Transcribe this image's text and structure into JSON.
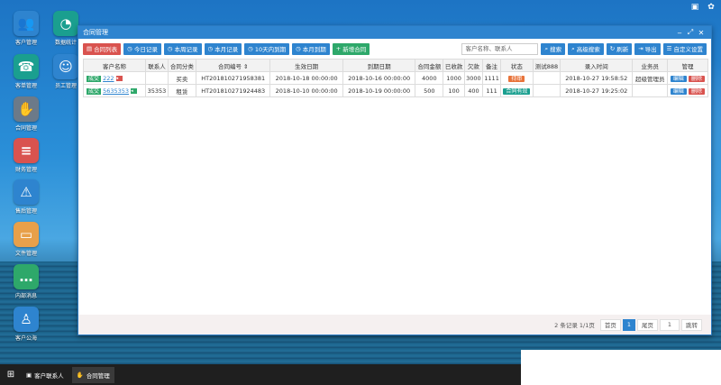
{
  "desktop": {
    "icons": [
      {
        "label": "客户管理",
        "icon": "users-icon",
        "color": "#2e84cf",
        "glyph": "👥"
      },
      {
        "label": "数据统计",
        "icon": "pie-chart-icon",
        "color": "#1a9f8f",
        "glyph": "◔"
      },
      {
        "label": "客单管理",
        "icon": "phone-icon",
        "color": "#1a9f8f",
        "glyph": "☎"
      },
      {
        "label": "员工管理",
        "icon": "user-icon",
        "color": "#2e84cf",
        "glyph": "☺"
      },
      {
        "label": "合同管理",
        "icon": "handshake-icon",
        "color": "#6c7a89",
        "glyph": "✋"
      },
      {
        "label": "财务管理",
        "icon": "database-icon",
        "color": "#d9534f",
        "glyph": "≡"
      },
      {
        "label": "售后管理",
        "icon": "warning-icon",
        "color": "#2e84cf",
        "glyph": "⚠"
      },
      {
        "label": "文件管理",
        "icon": "folder-icon",
        "color": "#e8a04a",
        "glyph": "▭"
      },
      {
        "label": "内部消息",
        "icon": "chat-icon",
        "color": "#2ea86a",
        "glyph": "…"
      },
      {
        "label": "客户公海",
        "icon": "person-icon",
        "color": "#2e84cf",
        "glyph": "♙"
      }
    ]
  },
  "window": {
    "title": "合同管理",
    "toolbar": {
      "filters": [
        {
          "label": "合同列表",
          "style": "red",
          "icon": "list-icon",
          "glyph": "▤"
        },
        {
          "label": "今日记录",
          "style": "blue",
          "icon": "clock-icon",
          "glyph": "◷"
        },
        {
          "label": "本周记录",
          "style": "blue",
          "icon": "clock-icon",
          "glyph": "◷"
        },
        {
          "label": "本月记录",
          "style": "blue",
          "icon": "clock-icon",
          "glyph": "◷"
        },
        {
          "label": "10天内到期",
          "style": "blue",
          "icon": "clock-icon",
          "glyph": "◷"
        },
        {
          "label": "本月到期",
          "style": "blue",
          "icon": "clock-icon",
          "glyph": "◷"
        },
        {
          "label": "新增合同",
          "style": "green",
          "icon": "plus-icon",
          "glyph": "+"
        }
      ],
      "search_placeholder": "客户名称、联系人",
      "actions": [
        {
          "label": "搜索",
          "icon": "search-icon",
          "glyph": "⌕"
        },
        {
          "label": "高级搜索",
          "icon": "search-icon",
          "glyph": "⌕"
        },
        {
          "label": "刷新",
          "icon": "refresh-icon",
          "glyph": "↻"
        },
        {
          "label": "导出",
          "icon": "export-icon",
          "glyph": "⇥"
        },
        {
          "label": "自定义设置",
          "icon": "settings-icon",
          "glyph": "☰"
        }
      ]
    },
    "table": {
      "columns": [
        "客户名称",
        "联系人",
        "合同分类",
        "合同编号 ⇕",
        "生效日期",
        "到期日期",
        "合同金额",
        "已收款",
        "欠款",
        "备注",
        "状态",
        "测试888",
        "录入时间",
        "业务员",
        "管理"
      ],
      "rows": [
        {
          "tag": "成交",
          "customer": "222",
          "flag_color": "#d9534f",
          "contact": "",
          "category": "买卖",
          "number": "HT201810271958381",
          "start": "2018-10-18 00:00:00",
          "end": "2018-10-16 00:00:00",
          "amount": "4000",
          "received": "1000",
          "debt": "3000",
          "note": "1111",
          "status": "待审",
          "status_color": "#e8733a",
          "test888": "",
          "created": "2018-10-27 19:58:52",
          "salesman": "超级管理员",
          "edit": "编辑",
          "delete": "删除"
        },
        {
          "tag": "成交",
          "customer": "5635353",
          "flag_color": "#2ea86a",
          "contact": "35353",
          "category": "租赁",
          "number": "HT201810271924483",
          "start": "2018-10-10 00:00:00",
          "end": "2018-10-19 00:00:00",
          "amount": "500",
          "received": "100",
          "debt": "400",
          "note": "111",
          "status": "合同有效",
          "status_color": "#1a9f8f",
          "test888": "",
          "created": "2018-10-27 19:25:02",
          "salesman": "",
          "edit": "编辑",
          "delete": "删除"
        }
      ]
    },
    "pager": {
      "info": "2 条记录 1/1页",
      "first": "首页",
      "current": "1",
      "last": "尾页",
      "goto_value": "1",
      "goto": "跳转"
    }
  },
  "taskbar": {
    "tasks": [
      {
        "label": "客户联系人",
        "icon": "contact-card-icon",
        "glyph": "▣"
      },
      {
        "label": "合同管理",
        "icon": "handshake-icon",
        "glyph": "✋"
      }
    ]
  },
  "colors": {
    "accent": "#2e84cf",
    "danger": "#d9534f",
    "success": "#2ea86a"
  }
}
